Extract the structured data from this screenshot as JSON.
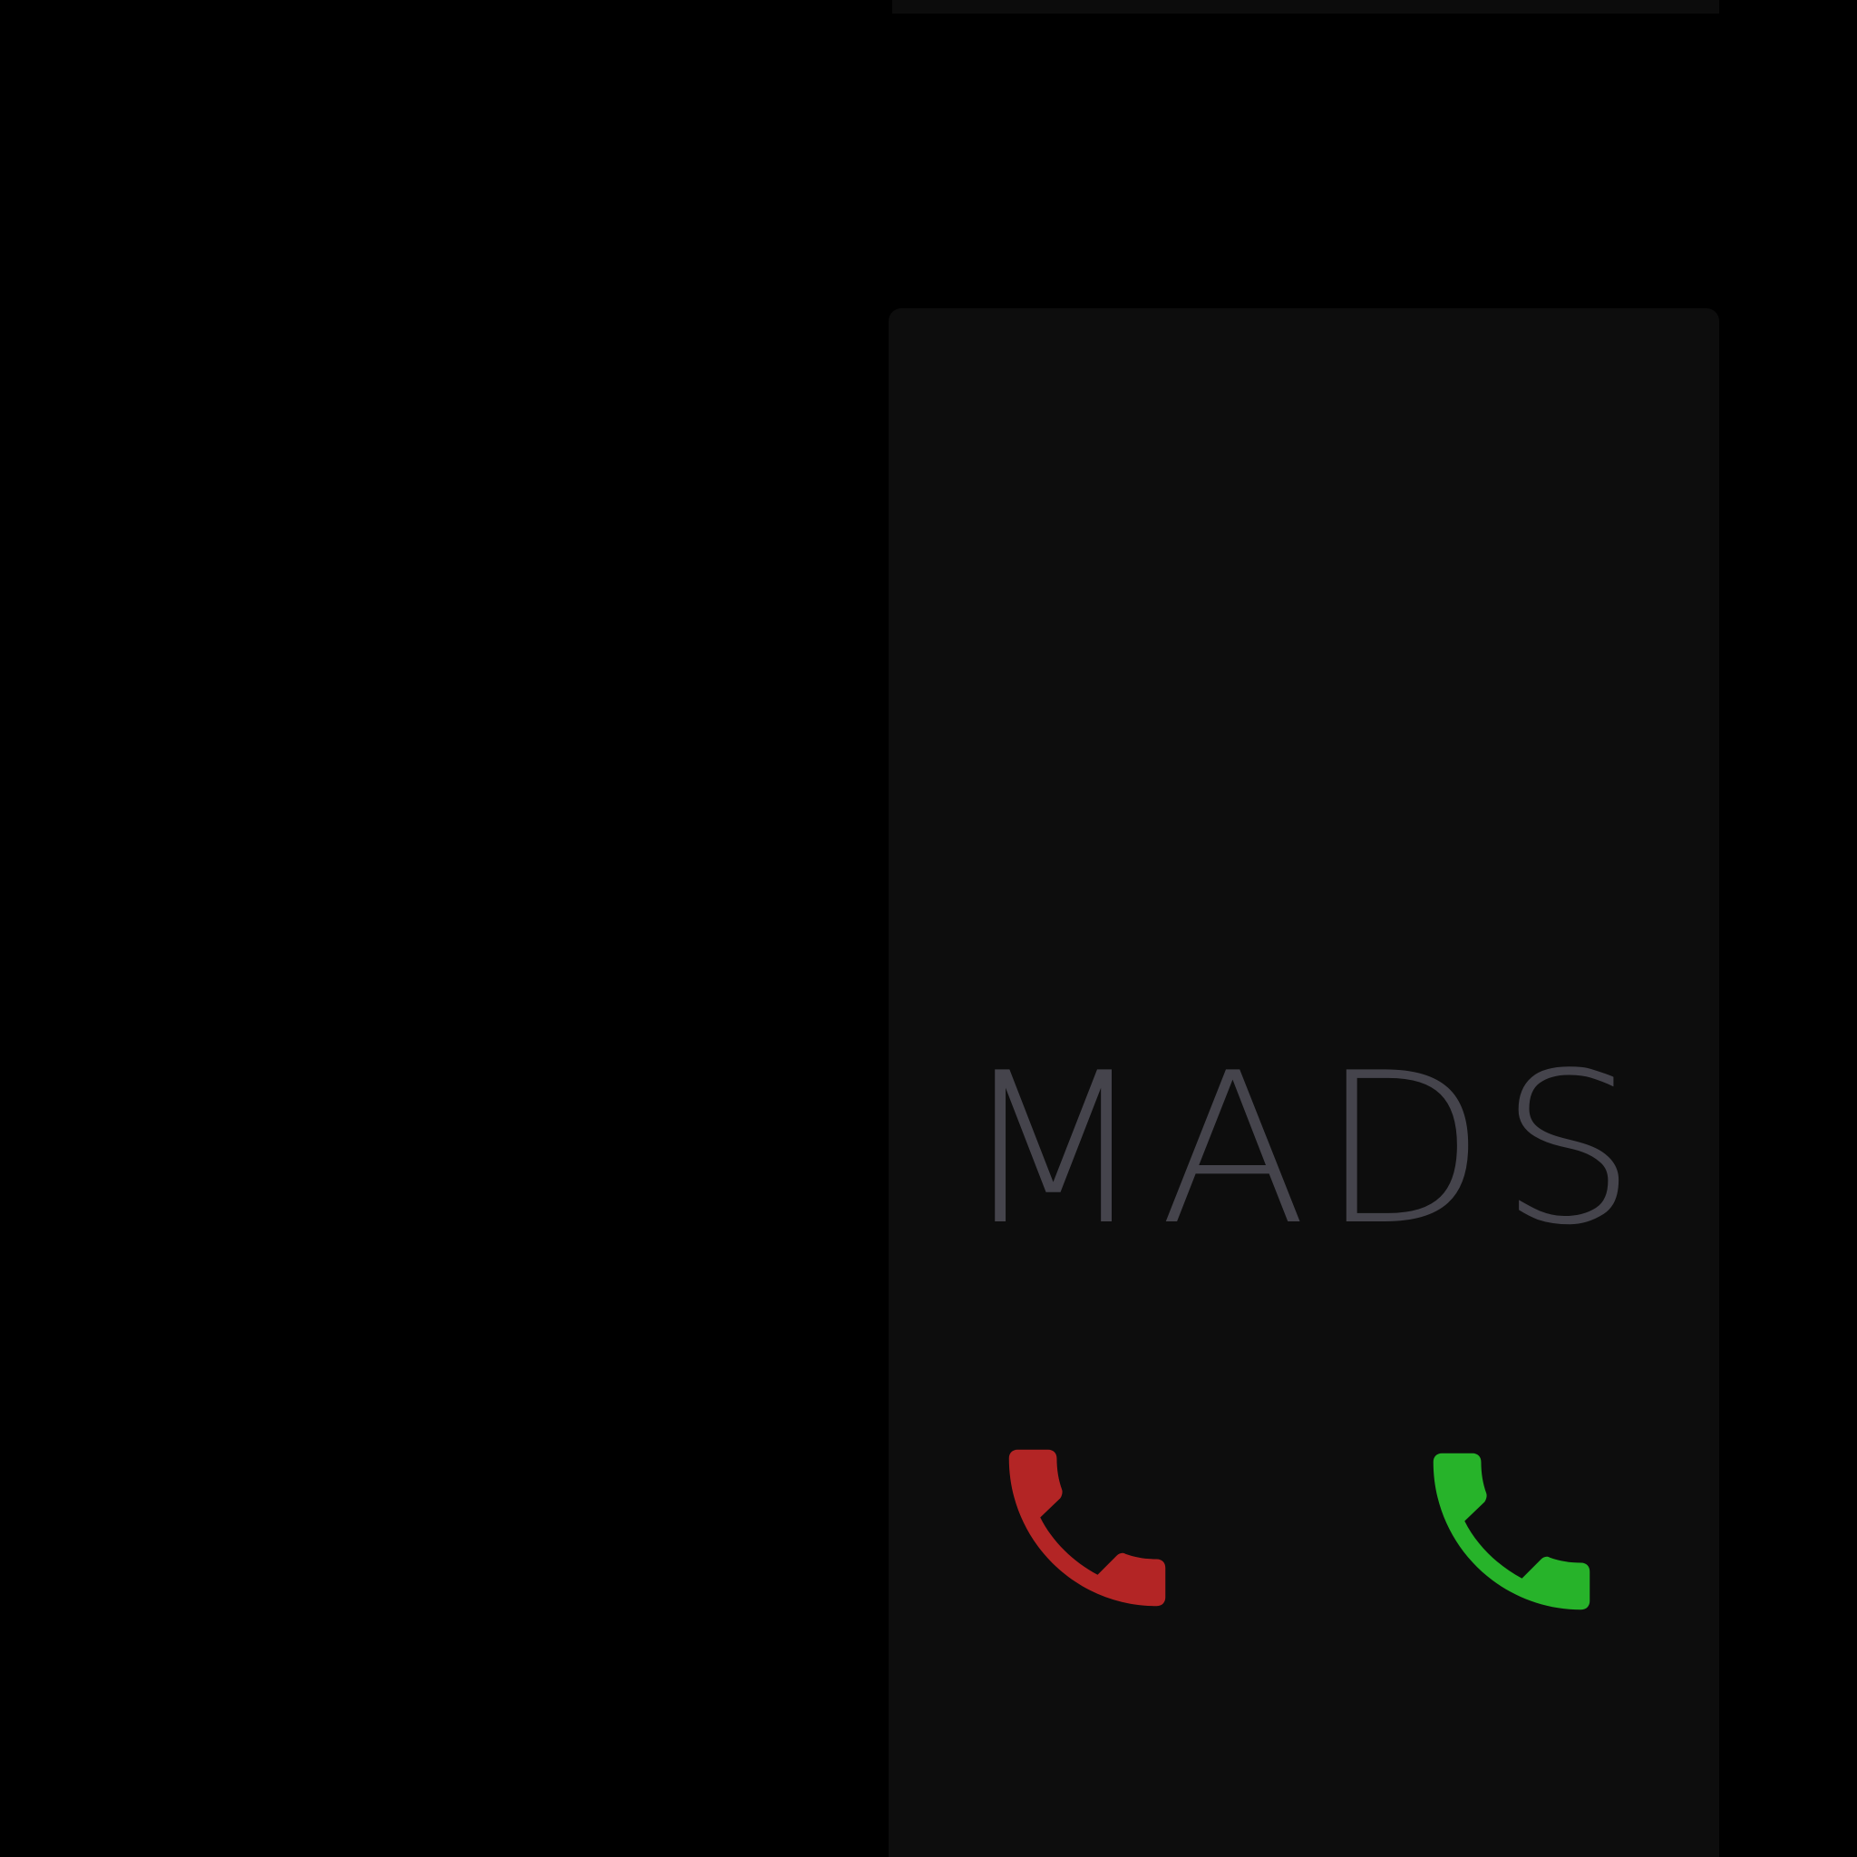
{
  "screen": {
    "background_color": "#000000",
    "panel_color": "#0d0d0d"
  },
  "incoming_call": {
    "caller_name": "MADS",
    "caller_name_color": "#45444c",
    "decline_icon": "phone-decline-icon",
    "decline_color": "#b32525",
    "accept_icon": "phone-accept-icon",
    "accept_color": "#27b32a"
  }
}
